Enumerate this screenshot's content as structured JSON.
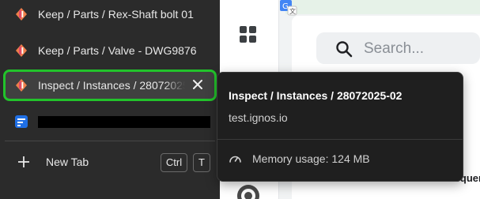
{
  "tabs": [
    {
      "title": "Keep / Parts / Rex-Shaft bolt 01",
      "favicon": "ignos-icon"
    },
    {
      "title": "Keep / Parts / Valve - DWG9876",
      "favicon": "ignos-icon"
    },
    {
      "title": "Inspect / Instances / 28072025-02",
      "favicon": "ignos-icon",
      "active": true
    },
    {
      "title": "",
      "favicon": "blue-app-icon",
      "redacted": true
    }
  ],
  "new_tab": {
    "label": "New Tab",
    "shortcut_keys": [
      "Ctrl",
      "T"
    ]
  },
  "tooltip": {
    "title": "Inspect / Instances / 28072025-02",
    "url": "test.ignos.io",
    "memory": "Memory usage: 124 MB"
  },
  "background_page": {
    "search_placeholder": "Search...",
    "partial_heading": "Sequer"
  },
  "colors": {
    "highlight": "#22c32b",
    "panel": "#2b2b2b",
    "tooltip": "#1f1f1f"
  }
}
